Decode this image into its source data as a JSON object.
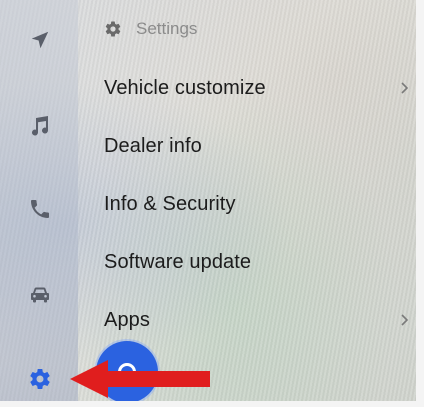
{
  "header": {
    "title": "Settings",
    "icon": "gear-icon"
  },
  "rail": {
    "items": [
      {
        "name": "navigation-arrow-icon"
      },
      {
        "name": "music-note-icon"
      },
      {
        "name": "phone-icon"
      },
      {
        "name": "car-icon"
      },
      {
        "name": "gear-icon",
        "active": true
      }
    ]
  },
  "menu": {
    "items": [
      {
        "label": "Vehicle customize",
        "has_chevron": true
      },
      {
        "label": "Dealer info",
        "has_chevron": false
      },
      {
        "label": "Info & Security",
        "has_chevron": false
      },
      {
        "label": "Software update",
        "has_chevron": false
      },
      {
        "label": "Apps",
        "has_chevron": true
      }
    ]
  },
  "colors": {
    "accent_blue": "#2b62e0",
    "annotation_red": "#e01e1e",
    "rail_icon": "#5a5f6a",
    "text": "#1c1c1c"
  }
}
